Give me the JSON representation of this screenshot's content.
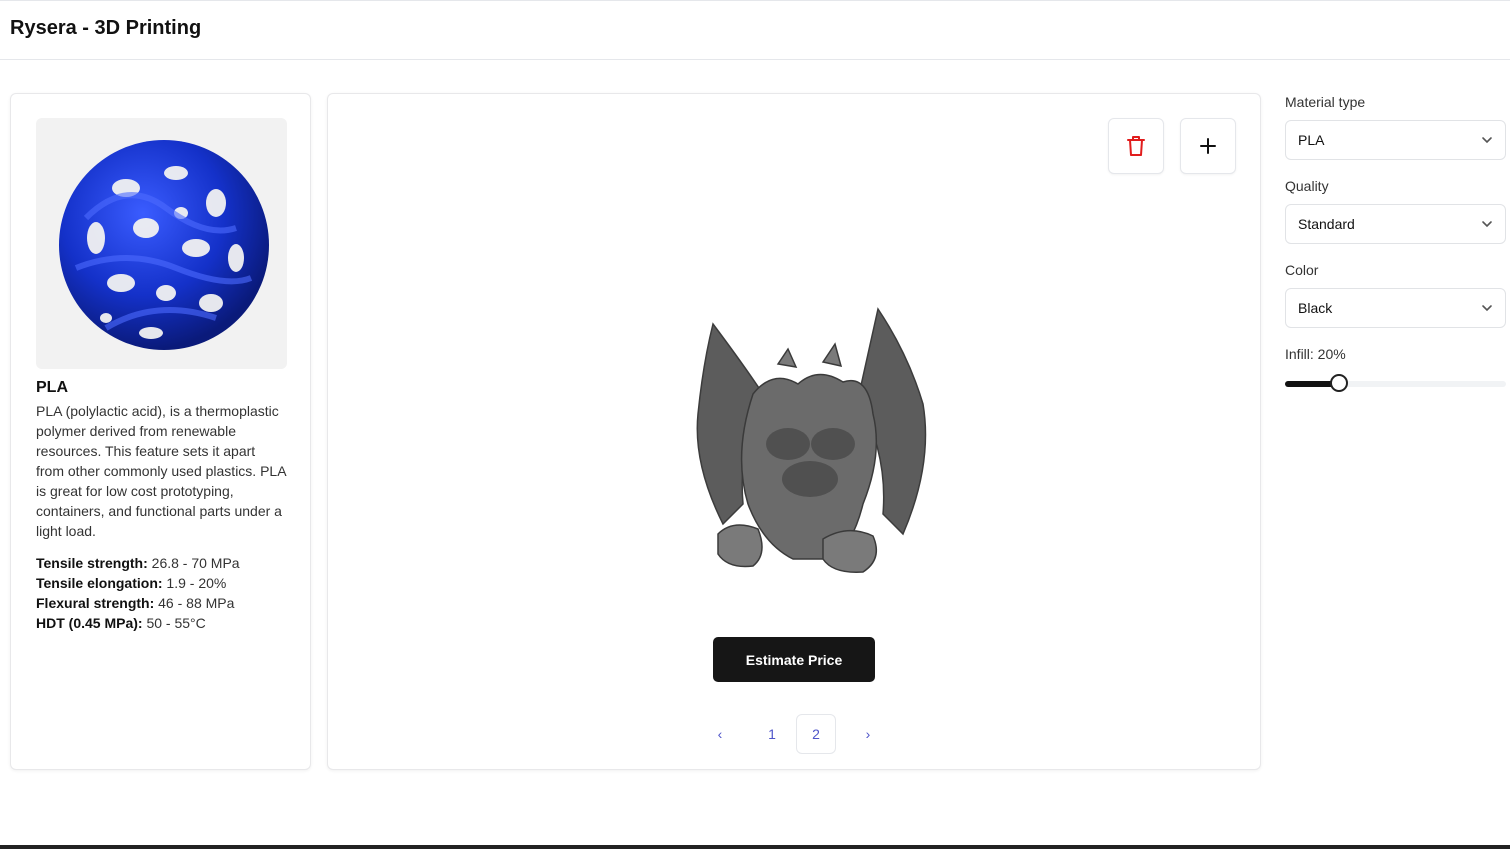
{
  "header": {
    "title": "Rysera - 3D Printing"
  },
  "material_card": {
    "image_icon": "blue-lattice-sphere",
    "name": "PLA",
    "description": "PLA (polylactic acid), is a thermoplastic polymer derived from renewable resources. This feature sets it apart from other commonly used plastics. PLA is great for low cost prototyping, containers, and functional parts under a light load.",
    "properties": [
      {
        "label": "Tensile strength:",
        "value": " 26.8 - 70 MPa"
      },
      {
        "label": "Tensile elongation:",
        "value": " 1.9 - 20%"
      },
      {
        "label": "Flexural strength:",
        "value": " 46 - 88 MPa"
      },
      {
        "label": "HDT (0.45 MPa):",
        "value": " 50 - 55°C"
      }
    ]
  },
  "viewer": {
    "delete_icon": "trash-icon",
    "add_icon": "plus-icon",
    "model_icon": "gargoyle-model",
    "estimate_label": "Estimate Price",
    "pagination": {
      "prev": "‹",
      "pages": [
        "1",
        "2"
      ],
      "current": "2",
      "next": "›"
    }
  },
  "settings": {
    "material_label": "Material type",
    "material_value": "PLA",
    "quality_label": "Quality",
    "quality_value": "Standard",
    "color_label": "Color",
    "color_value": "Black",
    "infill_label": "Infill: 20%",
    "infill_fraction": 0.2
  },
  "colors": {
    "accent": "#4f55c9",
    "delete": "#e11d1d",
    "primary_button": "#161616",
    "model_blue": "#1a3bd1"
  }
}
